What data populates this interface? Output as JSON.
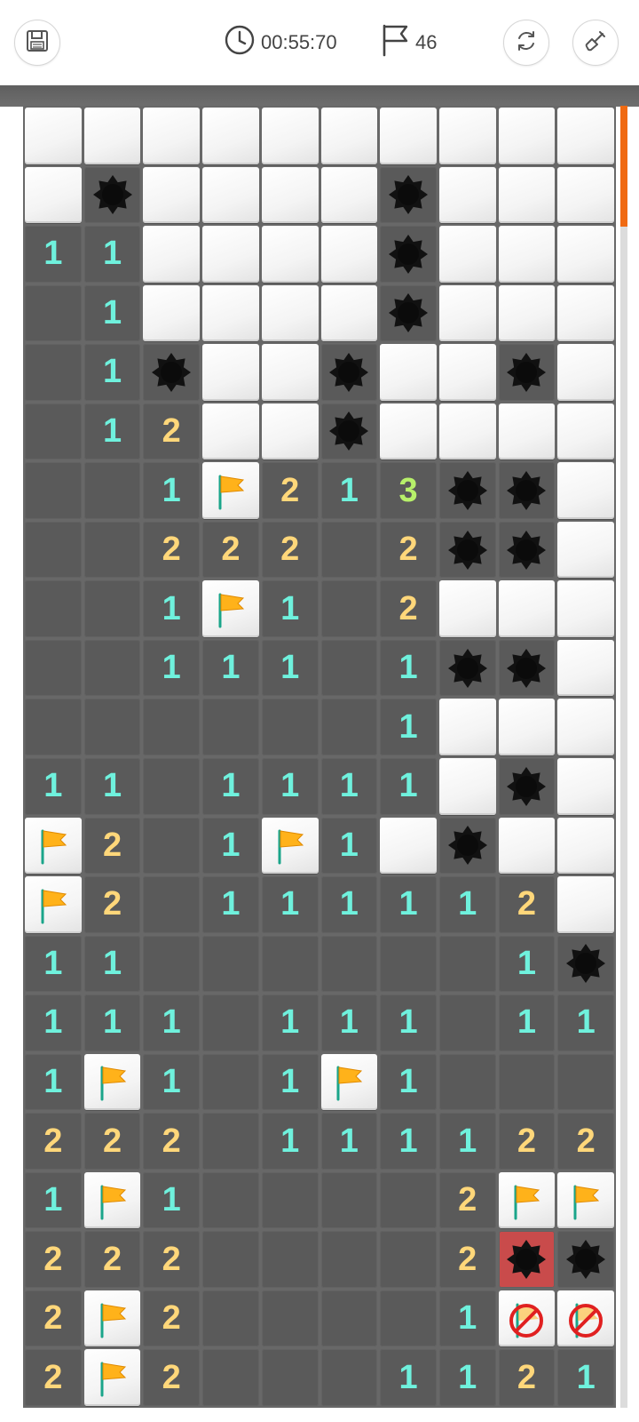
{
  "header": {
    "timer": "00:55:70",
    "flags_left": "46",
    "save_icon": "save-icon",
    "timer_icon": "clock-icon",
    "flag_icon": "flag-outline-icon",
    "refresh_icon": "refresh-icon",
    "shovel_icon": "shovel-icon"
  },
  "colors": {
    "number_1": "#6ff1dd",
    "number_2": "#ffd77a",
    "number_3": "#b7f06a",
    "accent": "#f06a12",
    "flag": "#ffb21a",
    "exploded": "#c94b4b"
  },
  "legend": {
    "U": "unrevealed",
    "E": "empty",
    "M": "mine",
    "F": "flag",
    "X": "exploded-mine",
    "W": "wrong-flag",
    "1": "number-1",
    "2": "number-2",
    "3": "number-3"
  },
  "board": {
    "columns": 10,
    "rows": [
      "UUUUUUUUUU",
      "UMUUUUMUUU",
      "11UUUUMUUU",
      "E1UUUUMUUU",
      "E1MUUMUUMU",
      "E12UUMUUUU",
      "EE1F213MMU",
      "EE222E2MMU",
      "EE1F1E2UUU",
      "EE111E1MMU",
      "EEEEEE1UUU",
      "11E1111UMU",
      "F2E1F1UMUU",
      "F2E111112U",
      "11EEEEEE1M",
      "111E111E11",
      "1F1E1F1EEE",
      "222E111122",
      "1F1EEEE2FF",
      "222EEEE2XM",
      "2F2EEEE1WW",
      "2F2EEE1121"
    ]
  }
}
